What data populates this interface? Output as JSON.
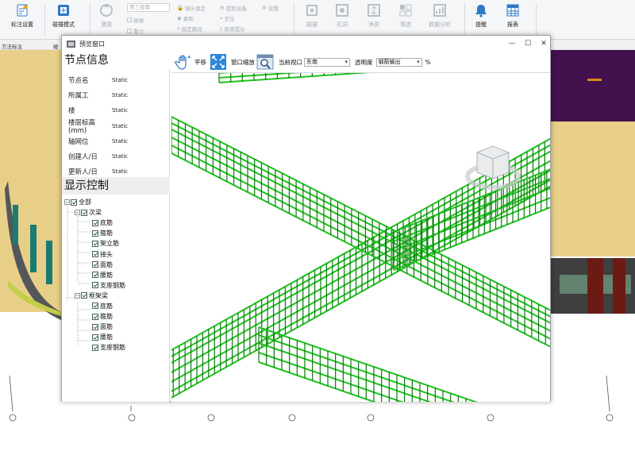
{
  "ribbon": {
    "left_button": "标注设置",
    "collide_mode": "碰撞模式",
    "roam": "漫游",
    "view_combo": "第三视角",
    "check_collide": "碰撞",
    "check_gravity": "重力",
    "lens_lock": "镜头锁定",
    "record": "录制",
    "specify_path": "指定路径",
    "extract_device": "提取设备",
    "locate": "定位",
    "dist_hint": "距离提示",
    "settings": "设置",
    "btn_collide": "碰撞",
    "btn_hole": "孔洞",
    "btn_clear": "净高",
    "btn_filter": "筛选",
    "btn_analysis": "数据分析",
    "btn_remind": "提醒",
    "btn_report": "报表",
    "group_left": "方法标注",
    "group_collide": "碰"
  },
  "dialog": {
    "title": "预览窗口",
    "min": "—",
    "max": "☐",
    "close": "✕"
  },
  "node_info": {
    "header": "节点信息",
    "rows": [
      {
        "label": "节点名",
        "value": "Static"
      },
      {
        "label": "所属工",
        "value": "Static"
      },
      {
        "label": "楼",
        "value": "Static"
      },
      {
        "label": "楼层标高(mm)",
        "value": "Static"
      },
      {
        "label": "轴网位",
        "value": "Static"
      },
      {
        "label": "创建人/日",
        "value": "Static"
      },
      {
        "label": "更新人/日",
        "value": "Static"
      }
    ]
  },
  "display_control": {
    "header": "显示控制",
    "root": "全部",
    "groups": [
      {
        "label": "次梁",
        "items": [
          "底筋",
          "箍筋",
          "架立筋",
          "接头",
          "面筋",
          "腰筋",
          "支座钢筋"
        ]
      },
      {
        "label": "框架梁",
        "items": [
          "底筋",
          "箍筋",
          "面筋",
          "腰筋",
          "支座钢筋"
        ]
      }
    ]
  },
  "toolbar": {
    "pan": "平移",
    "zoom_window": "窗口缩放",
    "view_label": "当前视口",
    "view_value": "东南",
    "transparency_label": "透明度",
    "transparency_value": "钢筋输出",
    "percent": "%"
  },
  "colors": {
    "rebar": "#1fc01f",
    "rebar_dark": "#0b7a0b",
    "model_tan": "#e8cf88",
    "model_purple": "#43114e"
  }
}
